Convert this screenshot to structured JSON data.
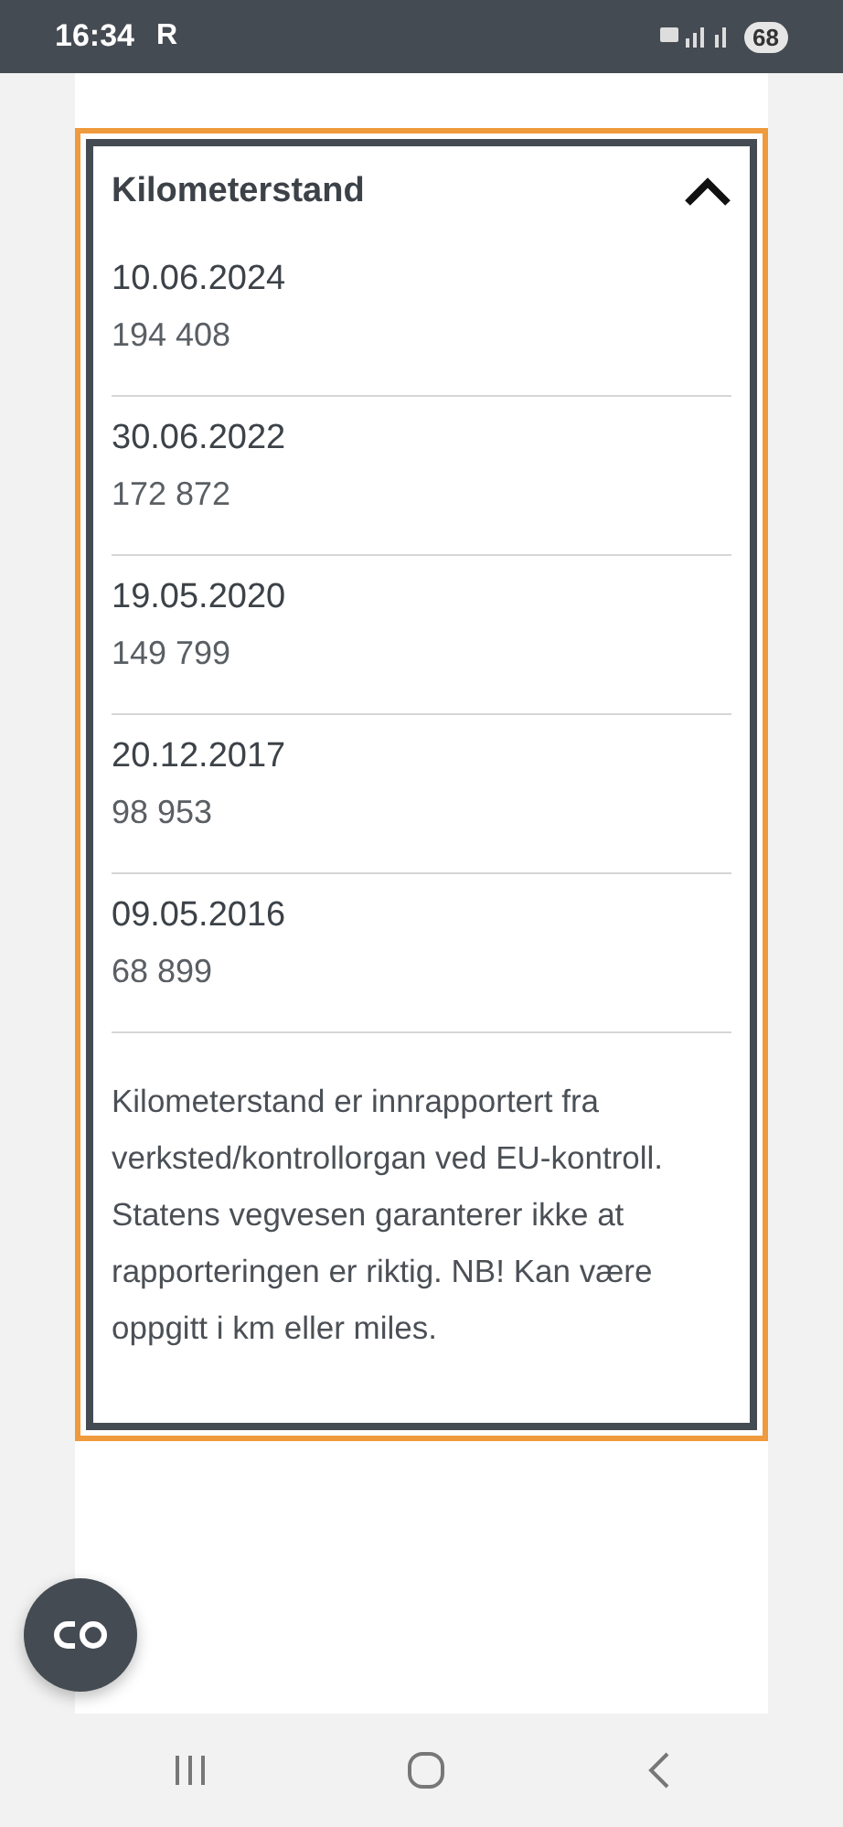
{
  "status_bar": {
    "time": "16:34",
    "carrier": "R",
    "battery": "68"
  },
  "section": {
    "title": "Kilometerstand",
    "expanded": true,
    "readings": [
      {
        "date": "10.06.2024",
        "value": "194 408"
      },
      {
        "date": "30.06.2022",
        "value": "172 872"
      },
      {
        "date": "19.05.2020",
        "value": "149 799"
      },
      {
        "date": "20.12.2017",
        "value": "98 953"
      },
      {
        "date": "09.05.2016",
        "value": "68 899"
      }
    ],
    "note": "Kilometerstand er innrapportert fra verksted/kontrollorgan ved EU-kontroll. Statens vegvesen garanterer ikke at rapporteringen er riktig. NB! Kan være oppgitt i km eller miles."
  }
}
